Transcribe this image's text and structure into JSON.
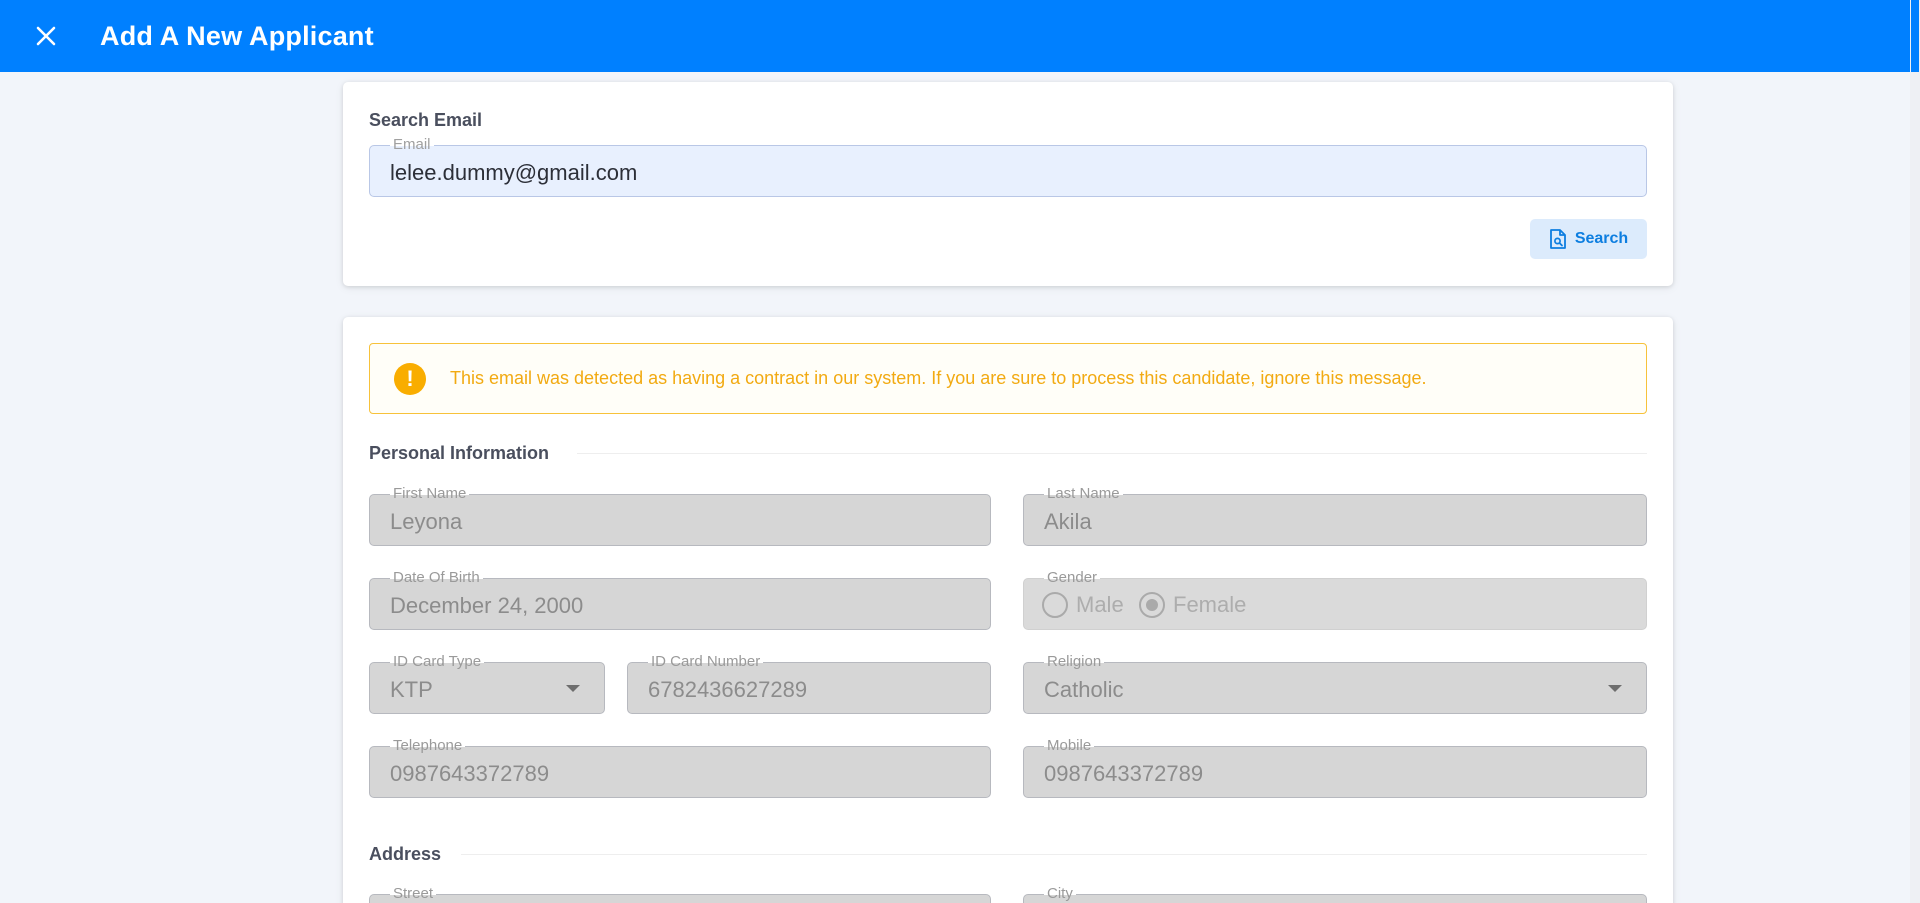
{
  "header": {
    "title": "Add A New Applicant",
    "close_icon": "close-icon",
    "background": "#0080ff"
  },
  "search_card": {
    "section_title": "Search Email",
    "email_label": "Email",
    "email_value": "lelee.dummy@gmail.com",
    "search_button_label": "Search",
    "search_icon": "file-search-icon"
  },
  "alert": {
    "icon": "exclamation-icon",
    "message": "This email was detected as having a contract in our system. If you are sure to process this candidate, ignore this message.",
    "color": "#f2aa12"
  },
  "personal": {
    "section_title": "Personal Information",
    "first_name_label": "First Name",
    "first_name_value": "Leyona",
    "last_name_label": "Last Name",
    "last_name_value": "Akila",
    "dob_label": "Date Of Birth",
    "dob_value": "December 24, 2000",
    "gender_label": "Gender",
    "gender_options": [
      "Male",
      "Female"
    ],
    "gender_selected": "Female",
    "id_type_label": "ID Card Type",
    "id_type_value": "KTP",
    "id_number_label": "ID Card Number",
    "id_number_value": "6782436627289",
    "religion_label": "Religion",
    "religion_value": "Catholic",
    "telephone_label": "Telephone",
    "telephone_value": "0987643372789",
    "mobile_label": "Mobile",
    "mobile_value": "0987643372789"
  },
  "address": {
    "section_title": "Address",
    "street_label": "Street",
    "city_label": "City"
  }
}
